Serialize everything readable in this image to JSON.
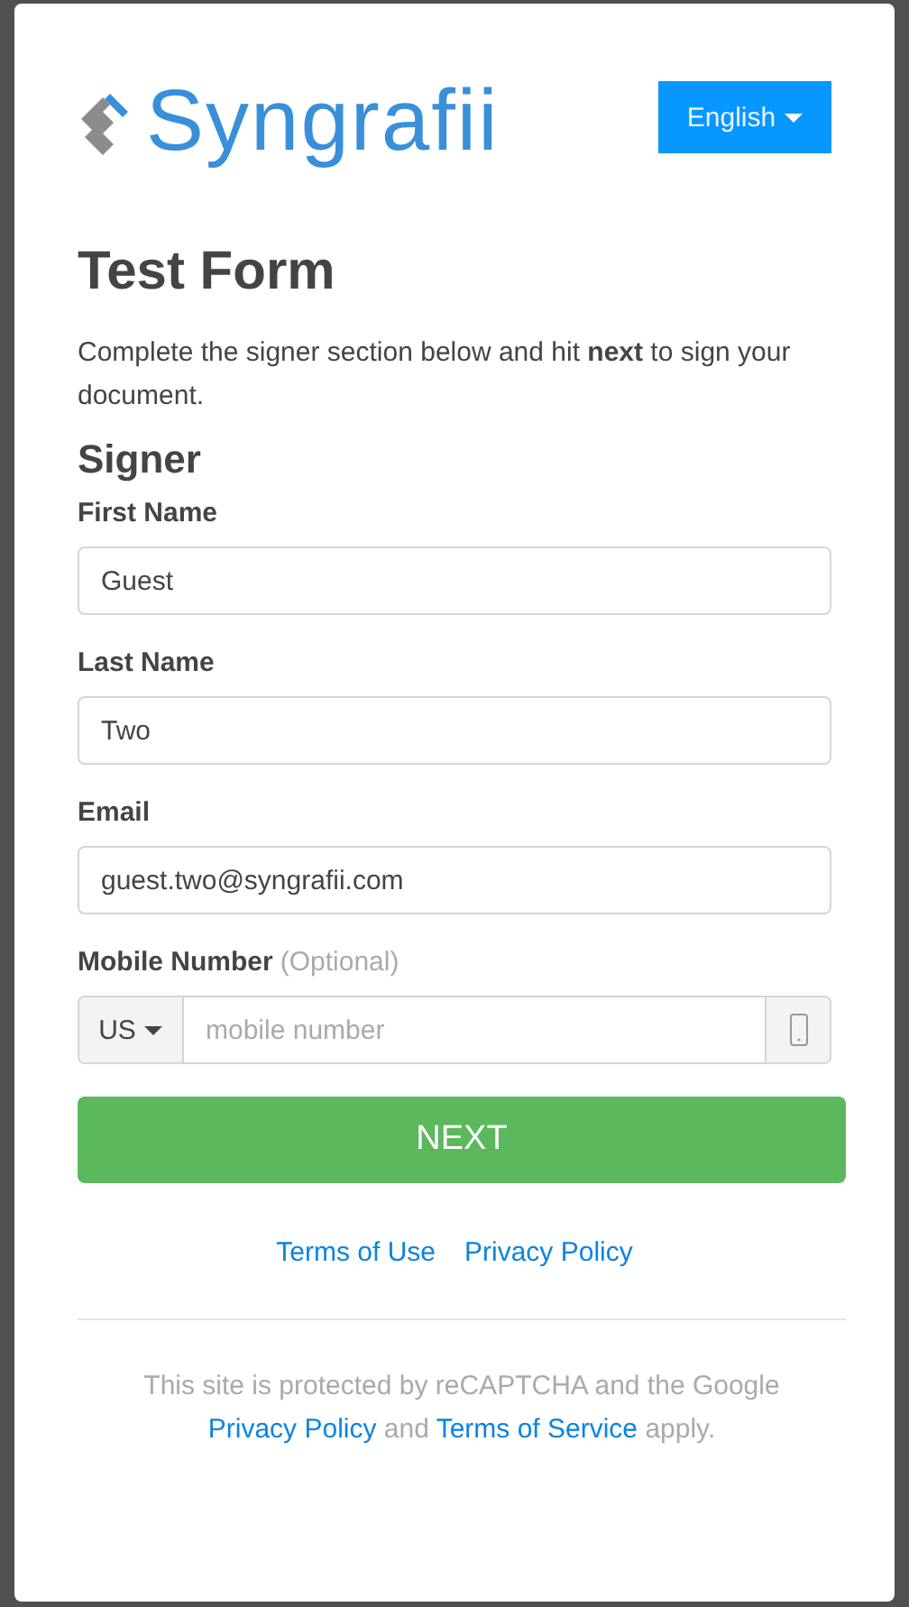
{
  "logo": {
    "text": "Syngrafii"
  },
  "language_button": {
    "label": "English"
  },
  "title": "Test Form",
  "intro": "Complete the signer section below and hit **next** to sign your document.",
  "section_title": "Signer",
  "fields": [
    {
      "kind": "text",
      "label": "First Name",
      "value": "Guest"
    },
    {
      "kind": "text",
      "label": "Last Name",
      "value": "Two"
    },
    {
      "kind": "text",
      "label": "Email",
      "value": "guest.two@syngrafii.com"
    },
    {
      "kind": "phone",
      "label": "Mobile Number",
      "hint": "(Optional)",
      "country": "US",
      "placeholder": "mobile number"
    }
  ],
  "next_button": "NEXT",
  "links": [
    "Terms of Use",
    "Privacy Policy"
  ],
  "footer": [
    {
      "text": "This site is protected by reCAPTCHA and the Google ",
      "link": false
    },
    {
      "text": "Privacy Policy",
      "link": true
    },
    {
      "text": " and ",
      "link": false
    },
    {
      "text": "Terms of Service",
      "link": true
    },
    {
      "text": " apply.",
      "link": false
    }
  ]
}
